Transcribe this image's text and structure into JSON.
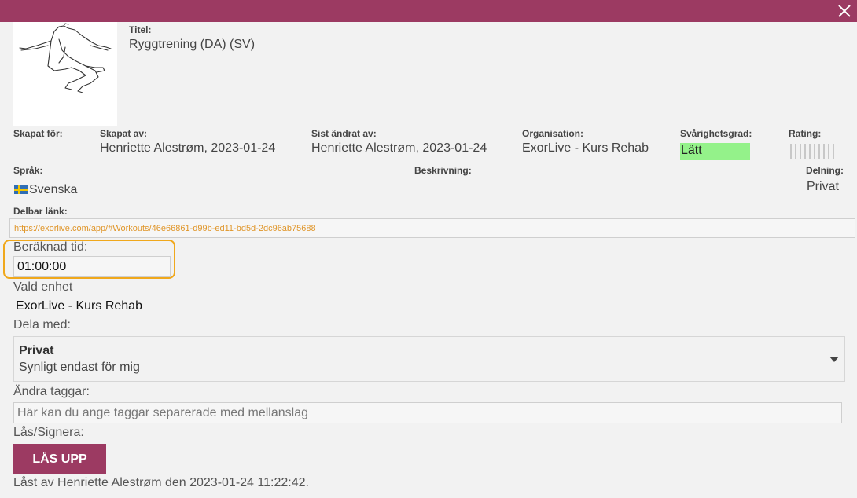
{
  "window": {
    "close_icon": "close-icon",
    "accent_color": "#9c3a62"
  },
  "exercise": {
    "title_label": "Titel:",
    "title": "Ryggtrening (DA) (SV)"
  },
  "meta": {
    "created_for_label": "Skapat för:",
    "created_by_label": "Skapat av:",
    "created_by": "Henriette Alestrøm, 2023-01-24",
    "last_modified_label": "Sist ändrat av:",
    "last_modified": "Henriette Alestrøm, 2023-01-24",
    "organisation_label": "Organisation:",
    "organisation": "ExorLive - Kurs Rehab",
    "difficulty_label": "Svårighetsgrad:",
    "difficulty": "Lätt",
    "difficulty_color": "#94f28a",
    "rating_label": "Rating:",
    "rating_value": 0,
    "language_label": "Språk:",
    "language": "Svenska",
    "language_flag": "swedish-flag-icon",
    "description_label": "Beskrivning:",
    "sharing_label": "Delning:",
    "sharing": "Privat"
  },
  "share_link": {
    "label": "Delbar länk:",
    "url": "https://exorlive.com/app/#Workouts/46e66861-d99b-ed11-bd5d-2dc96ab75688"
  },
  "form": {
    "estimated_time_label": "Beräknad tid:",
    "estimated_time": "01:00:00",
    "unit_label": "Vald enhet",
    "unit": "ExorLive - Kurs Rehab",
    "share_with_label": "Dela med:",
    "share_with_title": "Privat",
    "share_with_desc": "Synligt endast för mig",
    "tags_label": "Ändra taggar:",
    "tags_placeholder": "Här kan du ange taggar separerade med mellanslag",
    "lock_label": "Lås/Signera:",
    "unlock_button": "LÅS UPP",
    "locked_status": "Låst av Henriette Alestrøm den 2023-01-24 11:22:42."
  }
}
